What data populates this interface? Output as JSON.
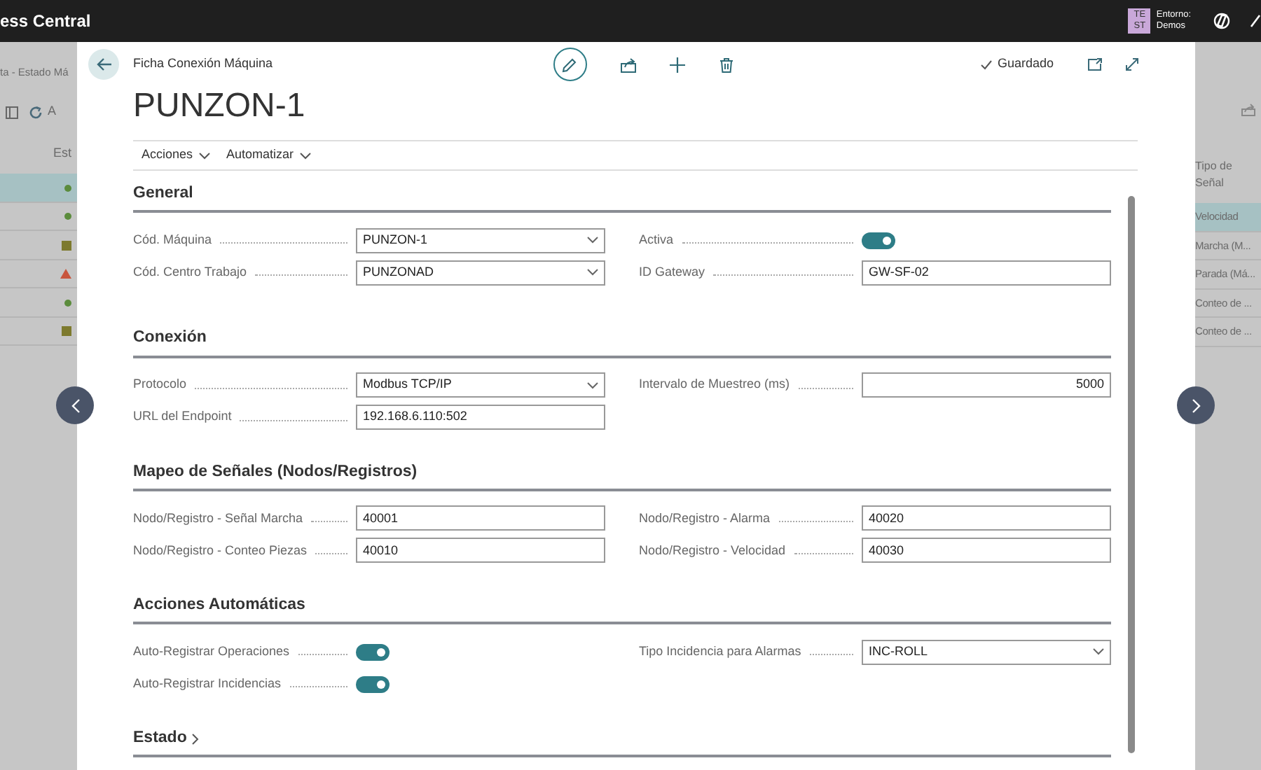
{
  "app_bar": {
    "title": "ess Central",
    "avatar_initials": [
      "TE",
      "ST"
    ],
    "environment_label": "Entorno:",
    "environment": "Demos"
  },
  "background_page": {
    "breadcrumb": "ta - Estado Má",
    "toolbar_text": "A",
    "column_header": "Est",
    "left_rows": [
      {
        "kind": "dot",
        "color": "#5b8c3c",
        "selected": true
      },
      {
        "kind": "dot",
        "color": "#5b8c3c",
        "selected": false
      },
      {
        "kind": "square",
        "color": "#7d7a2e",
        "selected": false
      },
      {
        "kind": "triangle",
        "color": "#c8553d",
        "selected": false
      },
      {
        "kind": "dot",
        "color": "#5b8c3c",
        "selected": false
      },
      {
        "kind": "square",
        "color": "#7d7a2e",
        "selected": false
      }
    ],
    "right_header": "Tipo de Señal",
    "right_rows": [
      {
        "text": "Velocidad",
        "selected": true
      },
      {
        "text": "Marcha (M...",
        "selected": false
      },
      {
        "text": "Parada (Má...",
        "selected": false
      },
      {
        "text": "Conteo de ...",
        "selected": false
      },
      {
        "text": "Conteo de ...",
        "selected": false
      }
    ]
  },
  "card": {
    "caption": "Ficha Conexión Máquina",
    "title": "PUNZON-1",
    "edit_mode": true,
    "save_status": "Guardado",
    "actions": [
      "Acciones",
      "Automatizar"
    ],
    "sections": [
      {
        "title": "General",
        "collapsed": false,
        "left": [
          {
            "label": "Cód. Máquina",
            "kind": "select",
            "value": "PUNZON-1"
          },
          {
            "label": "Cód. Centro Trabajo",
            "kind": "select",
            "value": "PUNZONAD"
          }
        ],
        "right": [
          {
            "label": "Activa",
            "kind": "toggle",
            "on": true
          },
          {
            "label": "ID Gateway",
            "kind": "input",
            "value": "GW-SF-02"
          }
        ]
      },
      {
        "title": "Conexión",
        "collapsed": false,
        "left": [
          {
            "label": "Protocolo",
            "kind": "select",
            "value": "Modbus TCP/IP"
          },
          {
            "label": "URL del Endpoint",
            "kind": "input",
            "value": "192.168.6.110:502"
          }
        ],
        "right": [
          {
            "label": "Intervalo de Muestreo (ms)",
            "kind": "number",
            "value": "5000"
          }
        ]
      },
      {
        "title": "Mapeo de Señales (Nodos/Registros)",
        "collapsed": false,
        "left": [
          {
            "label": "Nodo/Registro - Señal Marcha",
            "kind": "input",
            "value": "40001"
          },
          {
            "label": "Nodo/Registro - Conteo Piezas",
            "kind": "input",
            "value": "40010"
          }
        ],
        "right": [
          {
            "label": "Nodo/Registro - Alarma",
            "kind": "input",
            "value": "40020"
          },
          {
            "label": "Nodo/Registro - Velocidad",
            "kind": "input",
            "value": "40030"
          }
        ]
      },
      {
        "title": "Acciones Automáticas",
        "collapsed": false,
        "left": [
          {
            "label": "Auto-Registrar Operaciones",
            "kind": "toggle",
            "on": true
          },
          {
            "label": "Auto-Registrar Incidencias",
            "kind": "toggle",
            "on": true
          }
        ],
        "right": [
          {
            "label": "Tipo Incidencia para Alarmas",
            "kind": "select",
            "value": "INC-ROLL"
          }
        ]
      },
      {
        "title": "Estado",
        "collapsed": true
      }
    ]
  }
}
